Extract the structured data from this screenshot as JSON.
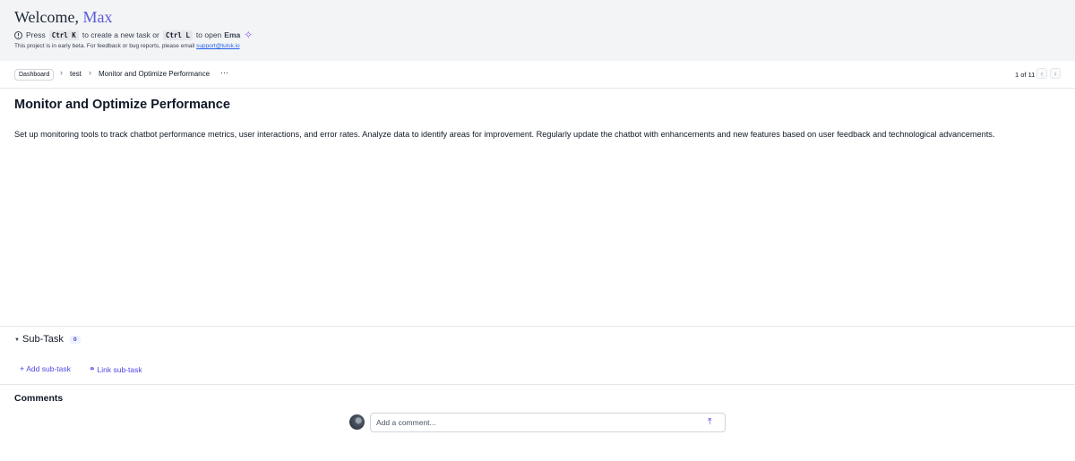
{
  "banner": {
    "greeting": "Welcome,",
    "user_name": "Max",
    "hint_press": "Press",
    "hint_key1": "Ctrl K",
    "hint_mid": "to create a new task or",
    "hint_key2": "Ctrl L",
    "hint_end": "to open",
    "hint_ema": "Ema",
    "beta_text": "This project is in early beta. For feedback or bug reports, please email",
    "support_email": "support@tulsk.io"
  },
  "breadcrumb": {
    "dashboard": "Dashboard",
    "project": "test",
    "current": "Monitor and Optimize Performance",
    "more": "···"
  },
  "pager": {
    "label": "1 of 11",
    "prev": "‹",
    "next": "›"
  },
  "task": {
    "title": "Monitor and Optimize Performance",
    "description": "Set up monitoring tools to track chatbot performance metrics, user interactions, and error rates. Analyze data to identify areas for improvement. Regularly update the chatbot with enhancements and new features based on user feedback and technological advancements."
  },
  "subtasks": {
    "title": "Sub-Task",
    "count": "0",
    "add_label": "Add sub-task",
    "link_label": "Link sub-task"
  },
  "comments": {
    "title": "Comments",
    "placeholder": "Add a comment..."
  },
  "colors": {
    "accent": "#4f46e5",
    "name_accent": "#5b5bd6",
    "banner_bg": "#f3f4f6"
  }
}
